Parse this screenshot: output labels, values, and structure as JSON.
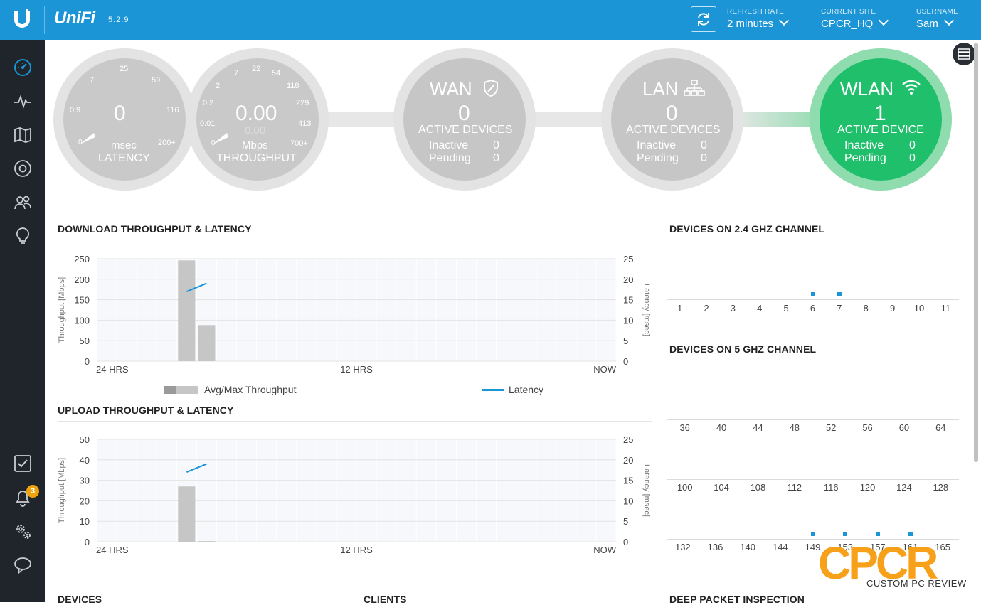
{
  "header": {
    "brand": "UniFi",
    "version": "5.2.9",
    "refresh_rate": {
      "label": "REFRESH RATE",
      "value": "2 minutes"
    },
    "current_site": {
      "label": "CURRENT SITE",
      "value": "CPCR_HQ"
    },
    "username": {
      "label": "USERNAME",
      "value": "Sam"
    },
    "accent_color": "#1b95d6"
  },
  "sidebar": {
    "items": [
      {
        "name": "dashboard",
        "icon": "dashboard-gauge-icon",
        "active": true
      },
      {
        "name": "statistics",
        "icon": "pulse-icon"
      },
      {
        "name": "map",
        "icon": "map-icon"
      },
      {
        "name": "devices",
        "icon": "target-icon"
      },
      {
        "name": "clients",
        "icon": "users-icon"
      },
      {
        "name": "insights",
        "icon": "lightbulb-icon"
      }
    ],
    "bottom_items": [
      {
        "name": "tasks",
        "icon": "checkbox-icon"
      },
      {
        "name": "alerts",
        "icon": "bell-icon",
        "badge": "3"
      },
      {
        "name": "settings",
        "icon": "gears-icon"
      },
      {
        "name": "support",
        "icon": "chat-bubble-icon"
      }
    ]
  },
  "topology": {
    "latency": {
      "value": "0",
      "unit": "msec",
      "label": "LATENCY",
      "ticks": [
        "0.9",
        "7",
        "25",
        "59",
        "116",
        "200+",
        "0"
      ]
    },
    "throughput": {
      "value": "0.00",
      "sub_value": "0.00",
      "unit": "Mbps",
      "label": "THROUGHPUT",
      "ticks": [
        "0.01",
        "0.2",
        "2",
        "7",
        "22",
        "54",
        "118",
        "229",
        "413",
        "700+",
        "0"
      ]
    },
    "wan": {
      "title": "WAN",
      "count": "0",
      "subtitle": "ACTIVE DEVICES",
      "inactive_label": "Inactive",
      "inactive": "0",
      "pending_label": "Pending",
      "pending": "0",
      "icon": "shield-icon"
    },
    "lan": {
      "title": "LAN",
      "count": "0",
      "subtitle": "ACTIVE DEVICES",
      "inactive_label": "Inactive",
      "inactive": "0",
      "pending_label": "Pending",
      "pending": "0",
      "icon": "network-tree-icon"
    },
    "wlan": {
      "title": "WLAN",
      "count": "1",
      "subtitle": "ACTIVE DEVICE",
      "inactive_label": "Inactive",
      "inactive": "0",
      "pending_label": "Pending",
      "pending": "0",
      "icon": "wifi-icon",
      "color": "#1fbf6b"
    }
  },
  "download_chart": {
    "title": "DOWNLOAD THROUGHPUT & LATENCY",
    "chart_data": {
      "type": "bar",
      "ylabel": "Throughput [Mbps]",
      "y2label": "Latency [msec]",
      "ylim": [
        0,
        250
      ],
      "y2lim": [
        0,
        25
      ],
      "y_ticks": [
        "0",
        "50",
        "100",
        "150",
        "200",
        "250"
      ],
      "y2_ticks": [
        "0",
        "5",
        "10",
        "15",
        "20",
        "25"
      ],
      "x_labels": [
        "24 HRS",
        "12 HRS",
        "NOW"
      ],
      "bars": [
        {
          "slot": 4,
          "value": 246
        },
        {
          "slot": 5,
          "value": 88
        }
      ],
      "latency": [
        {
          "slot": 4,
          "value": 17
        },
        {
          "slot": 5,
          "value": 19
        }
      ],
      "slots": 26
    },
    "legend": {
      "throughput": "Avg/Max Throughput",
      "latency": "Latency"
    }
  },
  "upload_chart": {
    "title": "UPLOAD THROUGHPUT & LATENCY",
    "chart_data": {
      "type": "bar",
      "ylabel": "Throughput [Mbps]",
      "y2label": "Latency [msec]",
      "ylim": [
        0,
        50
      ],
      "y2lim": [
        0,
        25
      ],
      "y_ticks": [
        "0",
        "10",
        "20",
        "30",
        "40",
        "50"
      ],
      "y2_ticks": [
        "0",
        "5",
        "10",
        "15",
        "20",
        "25"
      ],
      "x_labels": [
        "24 HRS",
        "12 HRS",
        "NOW"
      ],
      "bars": [
        {
          "slot": 4,
          "value": 27
        },
        {
          "slot": 5,
          "value": 0.3
        }
      ],
      "latency": [
        {
          "slot": 4,
          "value": 17
        },
        {
          "slot": 5,
          "value": 19
        }
      ],
      "slots": 26
    }
  },
  "channels_24": {
    "title": "DEVICES ON 2.4 GHZ CHANNEL",
    "channels": [
      "1",
      "2",
      "3",
      "4",
      "5",
      "6",
      "7",
      "8",
      "9",
      "10",
      "11"
    ],
    "active": [
      "6",
      "7"
    ]
  },
  "channels_5": {
    "title": "DEVICES ON 5 GHZ CHANNEL",
    "rows": [
      {
        "channels": [
          "36",
          "40",
          "44",
          "48",
          "52",
          "56",
          "60",
          "64"
        ],
        "active": []
      },
      {
        "channels": [
          "100",
          "104",
          "108",
          "112",
          "116",
          "120",
          "124",
          "128"
        ],
        "active": []
      },
      {
        "channels": [
          "132",
          "136",
          "140",
          "144",
          "149",
          "153",
          "157",
          "161",
          "165"
        ],
        "active": [
          "149",
          "153",
          "157",
          "161"
        ]
      }
    ]
  },
  "bottom_sections": {
    "devices": "DEVICES",
    "clients": "CLIENTS",
    "dpi": "DEEP PACKET INSPECTION"
  },
  "watermark": {
    "logo_text": "CPCR",
    "caption": "CUSTOM PC REVIEW",
    "color": "#f7a11a"
  }
}
